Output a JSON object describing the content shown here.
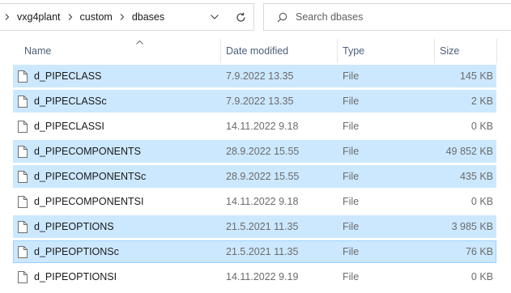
{
  "address": {
    "crumbs": [
      "vxg4plant",
      "custom",
      "dbases"
    ]
  },
  "search": {
    "placeholder": "Search dbases"
  },
  "columns": {
    "name": "Name",
    "date": "Date modified",
    "type": "Type",
    "size": "Size"
  },
  "files": [
    {
      "name": "d_PIPECLASS",
      "date": "7.9.2022 13.35",
      "type": "File",
      "size": "145 KB",
      "selected": true
    },
    {
      "name": "d_PIPECLASSc",
      "date": "7.9.2022 13.35",
      "type": "File",
      "size": "2 KB",
      "selected": true
    },
    {
      "name": "d_PIPECLASSI",
      "date": "14.11.2022 9.18",
      "type": "File",
      "size": "0 KB",
      "selected": false
    },
    {
      "name": "d_PIPECOMPONENTS",
      "date": "28.9.2022 15.55",
      "type": "File",
      "size": "49 852 KB",
      "selected": true
    },
    {
      "name": "d_PIPECOMPONENTSc",
      "date": "28.9.2022 15.55",
      "type": "File",
      "size": "435 KB",
      "selected": true
    },
    {
      "name": "d_PIPECOMPONENTSI",
      "date": "14.11.2022 9.18",
      "type": "File",
      "size": "0 KB",
      "selected": false
    },
    {
      "name": "d_PIPEOPTIONS",
      "date": "21.5.2021 11.35",
      "type": "File",
      "size": "3 985 KB",
      "selected": true
    },
    {
      "name": "d_PIPEOPTIONSc",
      "date": "21.5.2021 11.35",
      "type": "File",
      "size": "76 KB",
      "selected": true,
      "focused": true
    },
    {
      "name": "d_PIPEOPTIONSI",
      "date": "14.11.2022 9.19",
      "type": "File",
      "size": "0 KB",
      "selected": false
    }
  ]
}
